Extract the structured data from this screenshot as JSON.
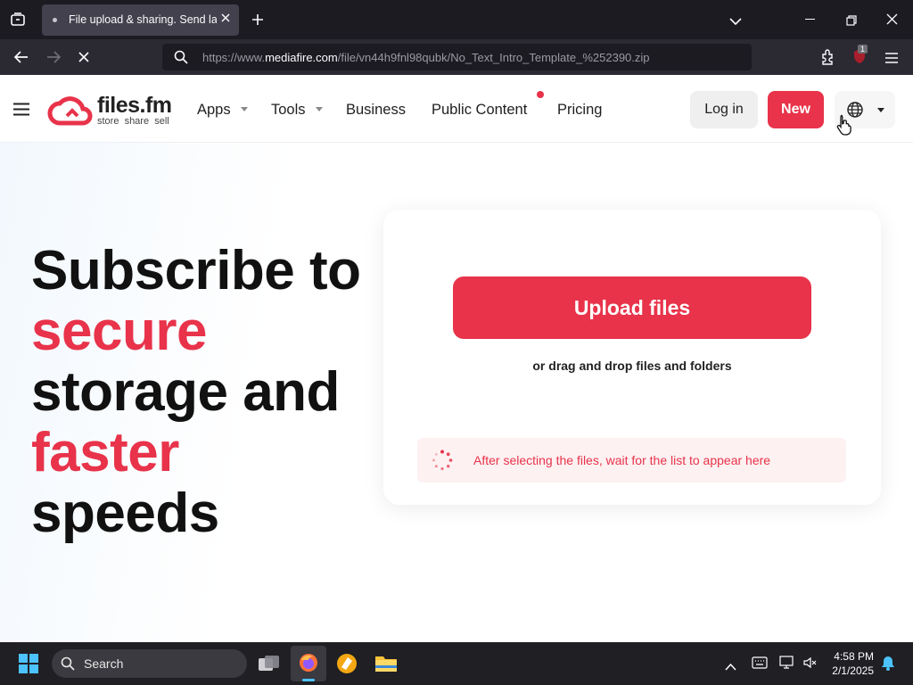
{
  "browser": {
    "tab_title": "File upload & sharing. Send large files",
    "url_prefix": "https://www.",
    "url_host": "mediafire.com",
    "url_path": "/file/vn44h9fnl98qubk/No_Text_Intro_Template_%252390.zip",
    "extension_badge": "1"
  },
  "site": {
    "logo_name": "files.fm",
    "logo_tagline": "store  share  sell",
    "nav": {
      "apps": "Apps",
      "tools": "Tools",
      "business": "Business",
      "public_content": "Public Content",
      "pricing": "Pricing"
    },
    "login_label": "Log in",
    "new_label": "New"
  },
  "hero": {
    "line1": "Subscribe to",
    "line2": "secure",
    "line3": "storage and",
    "line4": "faster",
    "line5": "speeds"
  },
  "upload": {
    "button_label": "Upload files",
    "drag_text": "or drag and drop files and folders",
    "status_text": "After selecting the files, wait for the list to appear here"
  },
  "taskbar": {
    "search_label": "Search",
    "time": "4:58 PM",
    "date": "2/1/2025"
  },
  "colors": {
    "brand_red": "#e8334a",
    "chrome_dark": "#1c1b22"
  }
}
